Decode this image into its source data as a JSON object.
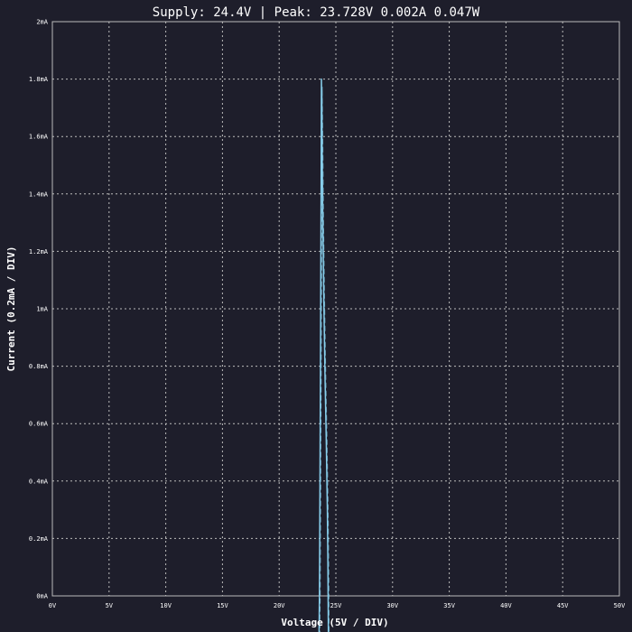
{
  "window": {
    "title": "Supply: 24.4V | Peak: 23.728V 0.002A 0.047W"
  },
  "chart_data": {
    "type": "line",
    "title": "Supply: 24.4V | Peak: 23.728V 0.002A 0.047W",
    "xlabel": "Voltage (5V / DIV)",
    "ylabel": "Current (0.2mA / DIV)",
    "xlim": [
      0,
      50
    ],
    "ylim": [
      0,
      2
    ],
    "x_unit": "V",
    "y_unit": "mA",
    "x_ticks": [
      "0V",
      "5V",
      "10V",
      "15V",
      "20V",
      "25V",
      "30V",
      "35V",
      "40V",
      "45V",
      "50V"
    ],
    "y_ticks": [
      "0mA",
      "0.2mA",
      "0.4mA",
      "0.6mA",
      "0.8mA",
      "1mA",
      "1.2mA",
      "1.4mA",
      "1.6mA",
      "1.8mA",
      "2mA"
    ],
    "grid": true,
    "grid_style": "dotted",
    "series": [
      {
        "color": "#87ceeb",
        "points": [
          [
            23.5,
            -0.2
          ],
          [
            23.55,
            0.0
          ],
          [
            23.6,
            0.4
          ],
          [
            23.65,
            0.9
          ],
          [
            23.7,
            1.4
          ],
          [
            23.72,
            1.7
          ],
          [
            23.728,
            1.8
          ],
          [
            23.78,
            1.6
          ],
          [
            23.85,
            1.3
          ],
          [
            23.95,
            1.0
          ],
          [
            24.05,
            0.75
          ],
          [
            24.15,
            0.55
          ],
          [
            24.25,
            0.3
          ],
          [
            24.3,
            0.1
          ],
          [
            24.35,
            -0.2
          ]
        ]
      }
    ],
    "colors": {
      "background": "#1e1e2b",
      "grid": "#bbbbbb",
      "trace": "#87ceeb",
      "text": "#ffffff"
    }
  }
}
